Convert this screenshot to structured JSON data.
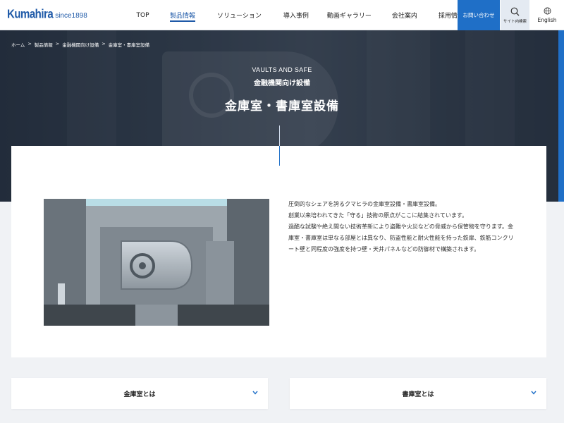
{
  "brand": {
    "logo_main": "Kumahira",
    "logo_sub": "since1898",
    "color": "#1f5aa8"
  },
  "nav": {
    "items": [
      {
        "label": "TOP",
        "active": false
      },
      {
        "label": "製品情報",
        "active": true
      },
      {
        "label": "ソリューション",
        "active": false
      },
      {
        "label": "導入事例",
        "active": false
      },
      {
        "label": "動画ギャラリー",
        "active": false
      },
      {
        "label": "会社案内",
        "active": false
      },
      {
        "label": "採用情報",
        "active": false
      }
    ],
    "contact_label": "お問い合わせ",
    "search_label": "サイト内検索",
    "lang_label": "English",
    "accent": "#1f6fc7"
  },
  "breadcrumb": [
    "ホーム",
    "製品情報",
    "金融機関向け設備",
    "金庫室・書庫室設備"
  ],
  "breadcrumb_separator": ">",
  "hero": {
    "eyebrow": "VAULTS AND SAFE",
    "subtitle": "金融機関向け設備",
    "title": "金庫室・書庫室設備"
  },
  "intro": {
    "paragraphs": [
      "圧倒的なシェアを誇るクマヒラの金庫室設備・書庫室設備。",
      "創業以来培われてきた「守る」技術の原点がここに結集されています。",
      "過酷な試験や絶え間ない技術革新により盗難や火災などの脅威から保管物を守ります。金庫室・書庫室は単なる部屋とは異なり、防盗性能と耐火性能を持った鉄扉、鉄筋コンクリート壁と同程度の強度を持つ壁・天井パネルなどの防御材で構築されます。"
    ]
  },
  "accordions": [
    {
      "label": "金庫室とは",
      "icon": "chevron-down-icon"
    },
    {
      "label": "書庫室とは",
      "icon": "chevron-down-icon"
    }
  ]
}
